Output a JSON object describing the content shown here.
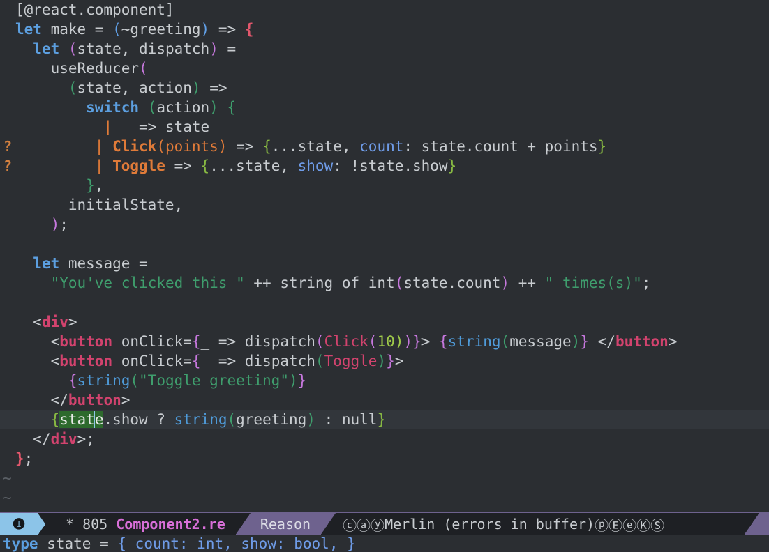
{
  "editor": {
    "background": "#2b2e32",
    "foreground": "#c8ccd0",
    "cursor_color": "#8fc6e8",
    "selection_color": "#2d6a2d",
    "fringe_marker": "?",
    "fringe_marker_color": "#d2803f",
    "empty_line_marker": "~"
  },
  "code": {
    "l01": "[@react.component]",
    "l02_let": "let",
    "l02_a": " make = ",
    "l02_p1": "(",
    "l02_b": "~greeting",
    "l02_p2": ")",
    "l02_c": " => ",
    "l02_brace": "{",
    "l03_let": "let",
    "l03_p1": " (",
    "l03_a": "state, dispatch",
    "l03_p2": ")",
    "l03_b": " =",
    "l04_a": "useReducer",
    "l04_p": "(",
    "l05_p1": "(",
    "l05_a": "state, action",
    "l05_p2": ")",
    "l05_b": " =>",
    "l06_kw": "switch",
    "l06_p1": " (",
    "l06_a": "action",
    "l06_p2": ")",
    "l06_brace": " {",
    "l07_bar": "|",
    "l07_a": " _ => state",
    "l08_bar": "|",
    "l08_ctor": " Click",
    "l08_p1": "(",
    "l08_arg": "points",
    "l08_p2": ")",
    "l08_arrow": " => ",
    "l08_brace1": "{",
    "l08_spread": "...state, ",
    "l08_field": "count",
    "l08_rest": ": state.count + points",
    "l08_brace2": "}",
    "l09_bar": "|",
    "l09_ctor": " Toggle",
    "l09_arrow": " => ",
    "l09_brace1": "{",
    "l09_spread": "...state, ",
    "l09_field": "show",
    "l09_rest": ": !state.show",
    "l09_brace2": "}",
    "l10_brace": "}",
    "l10_comma": ",",
    "l11": "initialState,",
    "l12_p": ")",
    "l12_semi": ";",
    "l14_let": "let",
    "l14_a": " message =",
    "l15_str1": "\"You've clicked this \"",
    "l15_op": " ++ ",
    "l15_fn": "string_of_int",
    "l15_p1": "(",
    "l15_arg": "state.count",
    "l15_p2": ")",
    "l15_op2": " ++ ",
    "l15_str2": "\" times(s)\"",
    "l15_semi": ";",
    "l17_lt": "<",
    "l17_tag": "div",
    "l17_gt": ">",
    "l18_lt": "<",
    "l18_tag": "button",
    "l18_attr": " onClick=",
    "l18_brace1": "{",
    "l18_fn": "_ => dispatch",
    "l18_p1": "(",
    "l18_ctor": "Click",
    "l18_p2": "(",
    "l18_num": "10",
    "l18_p3": ")",
    "l18_p4": ")",
    "l18_brace2": "}",
    "l18_gt": "> ",
    "l18_brace3": "{",
    "l18_string": "string",
    "l18_p5": "(",
    "l18_msg": "message",
    "l18_p6": ")",
    "l18_brace4": "}",
    "l18_close1": " </",
    "l18_close2": "button",
    "l18_close3": ">",
    "l19_lt": "<",
    "l19_tag": "button",
    "l19_attr": " onClick=",
    "l19_brace1": "{",
    "l19_fn": "_ => dispatch",
    "l19_p1": "(",
    "l19_ctor": "Toggle",
    "l19_p2": ")",
    "l19_brace2": "}",
    "l19_gt": ">",
    "l20_brace1": "{",
    "l20_string": "string",
    "l20_p1": "(",
    "l20_str": "\"Toggle greeting\"",
    "l20_p2": ")",
    "l20_brace2": "}",
    "l21_close1": "</",
    "l21_tag": "button",
    "l21_gt": ">",
    "l22_brace1": "{",
    "l22_sel": "stat",
    "l22_sel2": "e",
    "l22_mid": ".show ? ",
    "l22_string": "string",
    "l22_p1": "(",
    "l22_arg": "greeting",
    "l22_p2": ")",
    "l22_tail": " : null",
    "l22_brace2": "}",
    "l23_close1": "</",
    "l23_tag": "div",
    "l23_gt": ">",
    "l23_semi": ";",
    "l24_brace": "}",
    "l24_semi": ";"
  },
  "modeline": {
    "window_number": "❶",
    "modified_flag": "*",
    "buffer_number": "805",
    "buffer_name": "Component2.re",
    "major_mode": "Reason",
    "minor_modes_prefix": "ⓒⓐⓨ",
    "merlin_status": "Merlin (errors in buffer)",
    "minor_modes_suffix": "ⓟⒺⓔⓀⓈ",
    "accent_blue": "#8cc4e8",
    "accent_purple": "#6e628e",
    "buffer_name_color": "#d86fd8"
  },
  "minibuffer": {
    "kw": "type",
    "name": " state = ",
    "brace1": "{",
    "body": " count: int, show: bool, ",
    "brace2": "}"
  }
}
